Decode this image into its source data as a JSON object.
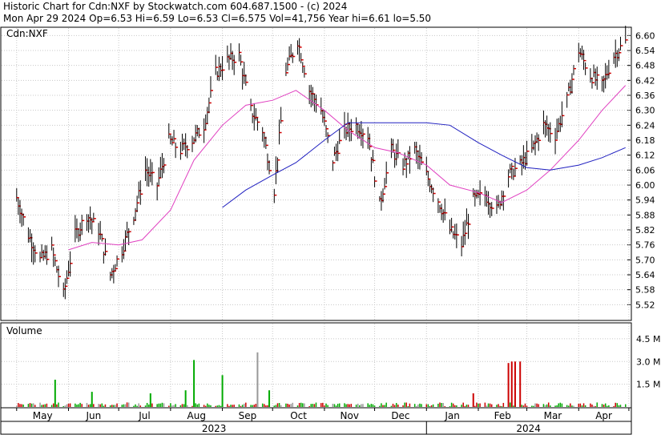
{
  "header": {
    "line1": "Historic Chart for Cdn:NXF by Stockwatch.com 604.687.1500 - (c) 2024",
    "line2": "Mon Apr 29 2024  Op=6.53  Hi=6.59  Lo=6.53  Cl=6.575  Vol=41,756  Year hi=6.61  lo=5.50"
  },
  "chart_data": [
    {
      "type": "ohlc",
      "title": "Cdn:NXF",
      "ylim": [
        5.46,
        6.63
      ],
      "y_ticks": [
        "6.60",
        "6.54",
        "6.48",
        "6.42",
        "6.36",
        "6.30",
        "6.24",
        "6.18",
        "6.12",
        "6.06",
        "6.00",
        "5.94",
        "5.88",
        "5.82",
        "5.76",
        "5.70",
        "5.64",
        "5.58",
        "5.52"
      ],
      "x_months": [
        "May",
        "Jun",
        "Jul",
        "Aug",
        "Sep",
        "Oct",
        "Nov",
        "Dec",
        "Jan",
        "Feb",
        "Mar",
        "Apr"
      ],
      "x_years": [
        "2023",
        "2024"
      ],
      "colors": {
        "bar": "#000000",
        "tick": "#cc0000",
        "ma_short": "#e040c0",
        "ma_long": "#2020c0"
      },
      "series": [
        {
          "name": "price_close_approx",
          "points": [
            [
              "2023-05-01",
              5.95
            ],
            [
              "2023-05-08",
              5.8
            ],
            [
              "2023-05-15",
              5.7
            ],
            [
              "2023-05-22",
              5.74
            ],
            [
              "2023-05-29",
              5.56
            ],
            [
              "2023-06-05",
              5.8
            ],
            [
              "2023-06-12",
              5.88
            ],
            [
              "2023-06-19",
              5.82
            ],
            [
              "2023-06-26",
              5.64
            ],
            [
              "2023-07-03",
              5.74
            ],
            [
              "2023-07-10",
              5.88
            ],
            [
              "2023-07-17",
              6.06
            ],
            [
              "2023-07-24",
              6.0
            ],
            [
              "2023-07-31",
              6.18
            ],
            [
              "2023-08-07",
              6.14
            ],
            [
              "2023-08-14",
              6.18
            ],
            [
              "2023-08-21",
              6.24
            ],
            [
              "2023-08-28",
              6.45
            ],
            [
              "2023-09-04",
              6.5
            ],
            [
              "2023-09-11",
              6.52
            ],
            [
              "2023-09-18",
              6.3
            ],
            [
              "2023-09-25",
              6.22
            ],
            [
              "2023-10-02",
              5.98
            ],
            [
              "2023-10-09",
              6.46
            ],
            [
              "2023-10-16",
              6.58
            ],
            [
              "2023-10-23",
              6.38
            ],
            [
              "2023-10-30",
              6.3
            ],
            [
              "2023-11-06",
              6.1
            ],
            [
              "2023-11-13",
              6.22
            ],
            [
              "2023-11-20",
              6.24
            ],
            [
              "2023-11-27",
              6.2
            ],
            [
              "2023-12-04",
              5.92
            ],
            [
              "2023-12-11",
              6.14
            ],
            [
              "2023-12-18",
              6.08
            ],
            [
              "2023-12-25",
              6.14
            ],
            [
              "2024-01-01",
              6.04
            ],
            [
              "2024-01-08",
              5.94
            ],
            [
              "2024-01-15",
              5.82
            ],
            [
              "2024-01-22",
              5.76
            ],
            [
              "2024-01-29",
              5.94
            ],
            [
              "2024-02-05",
              5.96
            ],
            [
              "2024-02-12",
              5.9
            ],
            [
              "2024-02-19",
              6.04
            ],
            [
              "2024-02-26",
              6.08
            ],
            [
              "2024-03-04",
              6.14
            ],
            [
              "2024-03-11",
              6.24
            ],
            [
              "2024-03-18",
              6.2
            ],
            [
              "2024-03-25",
              6.34
            ],
            [
              "2024-04-01",
              6.54
            ],
            [
              "2024-04-08",
              6.44
            ],
            [
              "2024-04-15",
              6.4
            ],
            [
              "2024-04-22",
              6.52
            ],
            [
              "2024-04-29",
              6.575
            ]
          ]
        },
        {
          "name": "ma_short",
          "points": [
            [
              "2023-06-01",
              5.74
            ],
            [
              "2023-06-15",
              5.77
            ],
            [
              "2023-07-01",
              5.76
            ],
            [
              "2023-07-15",
              5.78
            ],
            [
              "2023-08-01",
              5.9
            ],
            [
              "2023-08-15",
              6.1
            ],
            [
              "2023-09-01",
              6.24
            ],
            [
              "2023-09-15",
              6.32
            ],
            [
              "2023-10-01",
              6.34
            ],
            [
              "2023-10-15",
              6.38
            ],
            [
              "2023-11-01",
              6.3
            ],
            [
              "2023-11-15",
              6.22
            ],
            [
              "2023-12-01",
              6.15
            ],
            [
              "2023-12-15",
              6.13
            ],
            [
              "2024-01-01",
              6.08
            ],
            [
              "2024-01-15",
              6.0
            ],
            [
              "2024-02-01",
              5.97
            ],
            [
              "2024-02-15",
              5.93
            ],
            [
              "2024-03-01",
              5.98
            ],
            [
              "2024-03-15",
              6.06
            ],
            [
              "2024-04-01",
              6.18
            ],
            [
              "2024-04-15",
              6.3
            ],
            [
              "2024-04-29",
              6.4
            ]
          ]
        },
        {
          "name": "ma_long",
          "points": [
            [
              "2023-09-01",
              5.91
            ],
            [
              "2023-09-15",
              5.98
            ],
            [
              "2023-10-01",
              6.04
            ],
            [
              "2023-10-15",
              6.09
            ],
            [
              "2023-11-01",
              6.18
            ],
            [
              "2023-11-15",
              6.25
            ],
            [
              "2023-12-01",
              6.25
            ],
            [
              "2023-12-15",
              6.25
            ],
            [
              "2024-01-01",
              6.25
            ],
            [
              "2024-01-15",
              6.24
            ],
            [
              "2024-02-01",
              6.17
            ],
            [
              "2024-02-15",
              6.12
            ],
            [
              "2024-03-01",
              6.07
            ],
            [
              "2024-03-15",
              6.06
            ],
            [
              "2024-04-01",
              6.08
            ],
            [
              "2024-04-15",
              6.11
            ],
            [
              "2024-04-29",
              6.15
            ]
          ]
        }
      ]
    },
    {
      "type": "bar",
      "title": "Volume",
      "ylim": [
        0,
        5.5
      ],
      "y_ticks": [
        "4.5 M",
        "3.0 M",
        "1.5 M"
      ],
      "units": "M",
      "colors": {
        "up": "#00aa00",
        "down": "#cc0000",
        "flat": "#999999"
      },
      "notable_bars": [
        [
          "2023-05-24",
          1.8,
          "up"
        ],
        [
          "2023-06-15",
          1.0,
          "up"
        ],
        [
          "2023-07-20",
          0.9,
          "up"
        ],
        [
          "2023-08-10",
          1.1,
          "up"
        ],
        [
          "2023-08-15",
          3.1,
          "up"
        ],
        [
          "2023-09-01",
          2.1,
          "up"
        ],
        [
          "2023-09-22",
          3.6,
          "flat"
        ],
        [
          "2023-09-29",
          1.1,
          "up"
        ],
        [
          "2024-01-29",
          0.9,
          "down"
        ],
        [
          "2024-02-19",
          2.9,
          "down"
        ],
        [
          "2024-02-21",
          3.0,
          "down"
        ],
        [
          "2024-02-23",
          3.0,
          "down"
        ],
        [
          "2024-02-26",
          3.0,
          "down"
        ]
      ]
    }
  ]
}
